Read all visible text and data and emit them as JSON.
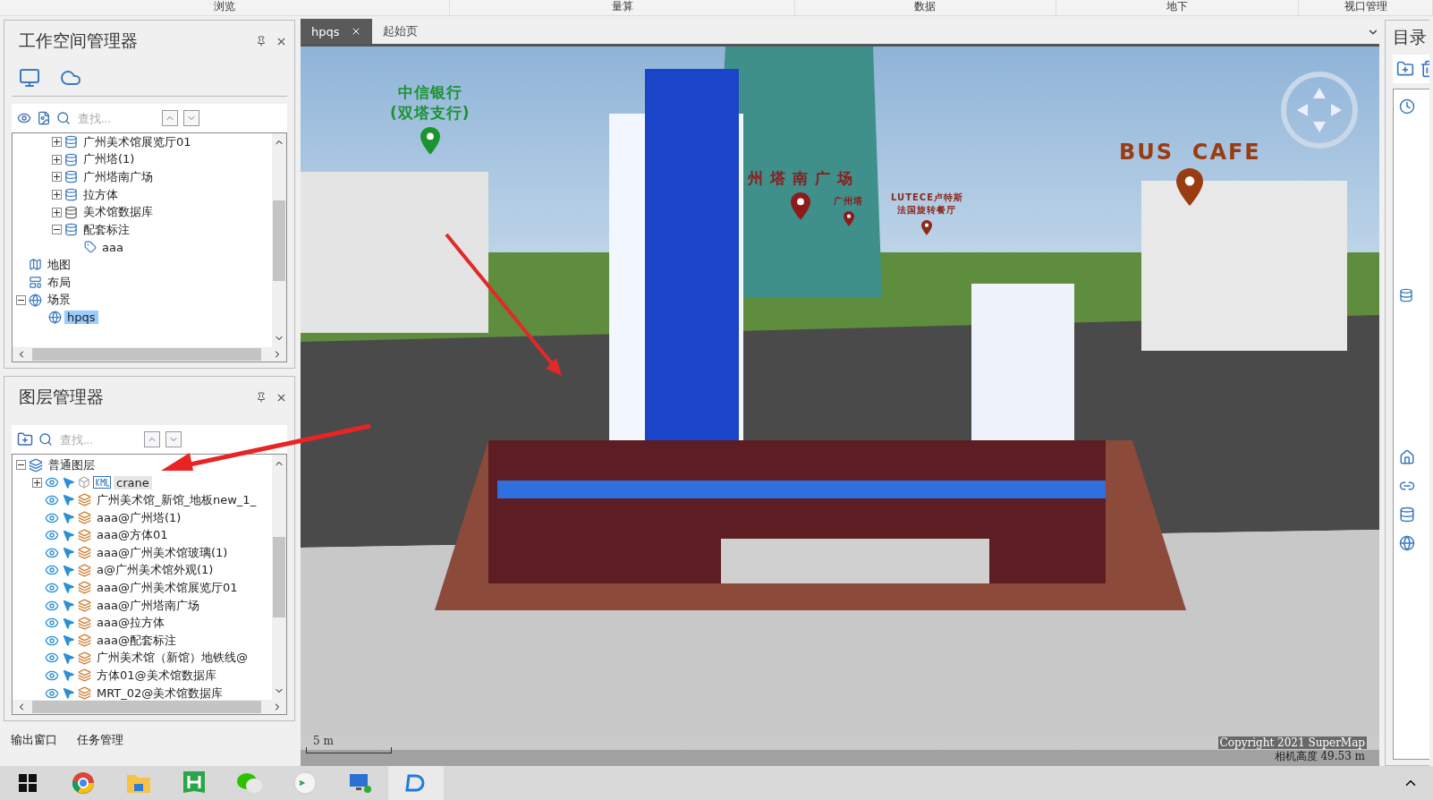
{
  "ribbon": {
    "groups": [
      "浏览",
      "量算",
      "数据",
      "地下",
      "视口管理"
    ]
  },
  "workspace": {
    "title": "工作空间管理器",
    "search": {
      "placeholder": "查找..."
    },
    "tree": [
      {
        "kind": "group",
        "children": [
          {
            "label": "广州美术馆展览厅01",
            "kind": "dataset",
            "expanded": false,
            "selected": false
          },
          {
            "label": "广州塔(1)",
            "kind": "dataset",
            "expanded": false,
            "selected": false
          },
          {
            "label": "广州塔南广场",
            "kind": "dataset",
            "expanded": false,
            "selected": false
          },
          {
            "label": "拉方体",
            "kind": "dataset",
            "expanded": false,
            "selected": false
          },
          {
            "label": "美术馆数据库",
            "kind": "udb",
            "expanded": false,
            "selected": false
          },
          {
            "label": "配套标注",
            "kind": "dataset",
            "expanded": true,
            "selected": false,
            "children": [
              {
                "label": "aaa",
                "kind": "label",
                "selected": false
              }
            ]
          }
        ]
      },
      {
        "label": "地图",
        "kind": "map",
        "selected": false
      },
      {
        "label": "布局",
        "kind": "layout",
        "selected": false
      },
      {
        "label": "场景",
        "kind": "scene",
        "expanded": true,
        "selected": false,
        "children": [
          {
            "label": "hpqs",
            "kind": "globe",
            "selected": true
          }
        ]
      }
    ]
  },
  "layers": {
    "title": "图层管理器",
    "search": {
      "placeholder": "查找..."
    },
    "root": {
      "label": "普通图层",
      "expanded": true,
      "children": [
        {
          "label": "crane",
          "kind": "kml",
          "expanded": false,
          "visible": true,
          "selectable": true,
          "selected": true
        },
        {
          "label": "广州美术馆_新馆_地板new_1_",
          "kind": "model",
          "visible": true,
          "selectable": true,
          "selected": false
        },
        {
          "label": "aaa@广州塔(1)",
          "kind": "model",
          "visible": true,
          "selectable": true,
          "selected": false
        },
        {
          "label": "aaa@方体01",
          "kind": "model",
          "visible": true,
          "selectable": true,
          "selected": false
        },
        {
          "label": "aaa@广州美术馆玻璃(1)",
          "kind": "model",
          "visible": true,
          "selectable": true,
          "selected": false
        },
        {
          "label": "a@广州美术馆外观(1)",
          "kind": "model",
          "visible": true,
          "selectable": true,
          "selected": false
        },
        {
          "label": "aaa@广州美术馆展览厅01",
          "kind": "model",
          "visible": true,
          "selectable": true,
          "selected": false
        },
        {
          "label": "aaa@广州塔南广场",
          "kind": "model",
          "visible": true,
          "selectable": true,
          "selected": false
        },
        {
          "label": "aaa@拉方体",
          "kind": "model",
          "visible": true,
          "selectable": true,
          "selected": false
        },
        {
          "label": "aaa@配套标注",
          "kind": "model",
          "visible": true,
          "selectable": true,
          "selected": false
        },
        {
          "label": "广州美术馆（新馆）地铁线@",
          "kind": "model",
          "visible": true,
          "selectable": true,
          "selected": false
        },
        {
          "label": "方体01@美术馆数据库",
          "kind": "model",
          "visible": true,
          "selectable": true,
          "selected": false
        },
        {
          "label": "MRT_02@美术馆数据库",
          "kind": "model",
          "visible": true,
          "selectable": true,
          "selected": false
        }
      ]
    }
  },
  "bottom_tabs": [
    {
      "label": "输出窗口",
      "selected": false
    },
    {
      "label": "任务管理",
      "selected": false
    }
  ],
  "doc_tabs": [
    {
      "label": "hpqs",
      "selected": true,
      "closable": true
    },
    {
      "label": "起始页",
      "selected": false,
      "closable": false
    }
  ],
  "scene": {
    "placemarks": [
      {
        "lines": [
          "中信银行",
          "(双塔支行)"
        ],
        "color": "#1a9430"
      },
      {
        "lines": [
          "州 塔 南 广 场"
        ],
        "color": "#8c1c1c"
      },
      {
        "lines": [
          "广州塔"
        ],
        "color": "#8c1c1c"
      },
      {
        "lines": [
          "LUTECE卢特斯",
          "法国旋转餐厅"
        ],
        "color": "#8c2a1c"
      },
      {
        "lines": [
          "BUS  CAFE"
        ],
        "color": "#9a3c12"
      }
    ],
    "scale": "5 m",
    "copyright": "Copyright 2021 SuperMap",
    "camera_height": "相机高度 49.53 m"
  },
  "catalog": {
    "title": "目录"
  }
}
